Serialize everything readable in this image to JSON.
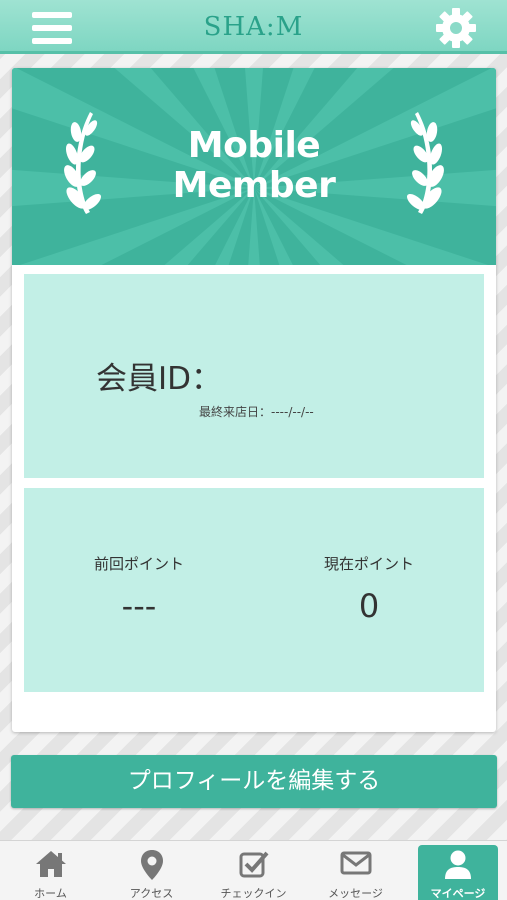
{
  "header": {
    "title": "SHA:M",
    "menu_icon": "hamburger-menu-icon",
    "settings_icon": "gear-icon",
    "accent_color": "#7ed6c2"
  },
  "banner": {
    "line1": "Mobile",
    "line2": "Member",
    "color": "#3fb39c"
  },
  "member": {
    "id_label": "会員ID：",
    "last_visit": "最終来店日：----/--/--"
  },
  "points": {
    "previous_label": "前回ポイント",
    "previous_value": "---",
    "current_label": "現在ポイント",
    "current_value": "0"
  },
  "edit_profile_label": "プロフィールを編集する",
  "tabs": [
    {
      "label": "ホーム",
      "icon": "home-icon"
    },
    {
      "label": "アクセス",
      "icon": "map-pin-icon"
    },
    {
      "label": "チェックイン",
      "icon": "checkbox-icon"
    },
    {
      "label": "メッセージ",
      "icon": "envelope-icon"
    },
    {
      "label": "マイページ",
      "icon": "user-icon",
      "active": true
    }
  ]
}
